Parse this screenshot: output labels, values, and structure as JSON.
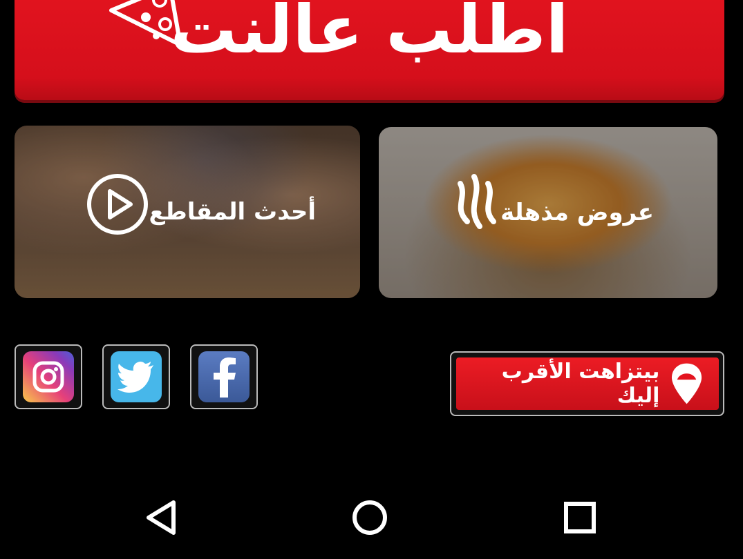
{
  "banner": {
    "label": "اطلب عالنت"
  },
  "tiles": [
    {
      "label": "أحدث المقاطع",
      "icon": "play-icon"
    },
    {
      "label": "عروض مذهلة",
      "icon": "brand-icon"
    }
  ],
  "social": [
    {
      "name": "instagram",
      "icon": "instagram-icon"
    },
    {
      "name": "twitter",
      "icon": "twitter-icon"
    },
    {
      "name": "facebook",
      "icon": "facebook-icon"
    }
  ],
  "store_locator": {
    "label": "بيتزاهت الأقرب إليك",
    "icon": "location-pin-icon"
  },
  "nav": {
    "back": "back-icon",
    "home": "home-icon",
    "recents": "recents-icon"
  },
  "colors": {
    "brand_red": "#e3141f",
    "background": "#000000"
  }
}
